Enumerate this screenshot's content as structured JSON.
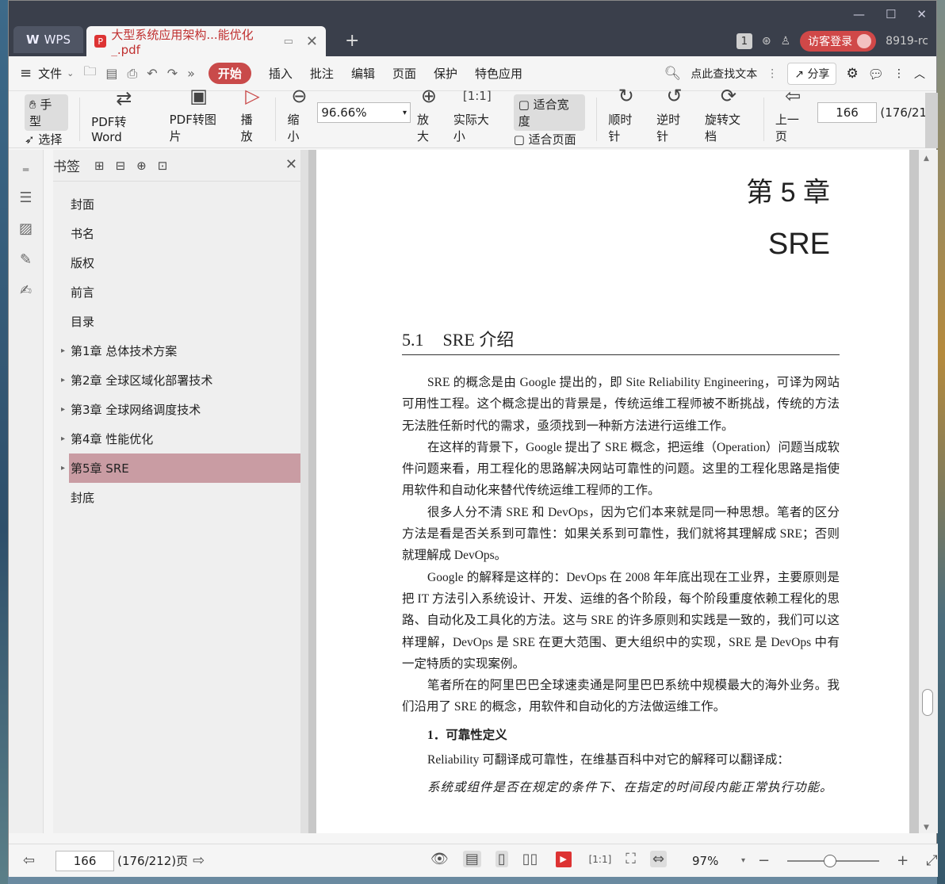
{
  "titlebar": {
    "wps_tab": "WPS",
    "doc_tab": "大型系统应用架构...能优化_.pdf",
    "guest_login": "访客登录",
    "user_id": "8919-rc",
    "window_count": "1"
  },
  "menubar": {
    "file": "文件",
    "tabs": [
      "开始",
      "插入",
      "批注",
      "编辑",
      "页面",
      "保护",
      "特色应用"
    ],
    "search": "点此查找文本",
    "share": "分享"
  },
  "ribbon": {
    "hand": "手型",
    "select": "选择",
    "pdf_to_word": "PDF转Word",
    "pdf_to_image": "PDF转图片",
    "play": "播放",
    "zoom_out": "缩小",
    "zoom_value": "96.66%",
    "zoom_in": "放大",
    "actual_size": "实际大小",
    "fit_width": "适合宽度",
    "fit_page": "适合页面",
    "rotate_cw": "顺时针",
    "rotate_ccw": "逆时针",
    "rotate_doc": "旋转文档",
    "prev_page": "上一页",
    "page_value": "166",
    "page_total": "(176/21"
  },
  "bookmarks": {
    "title": "书签",
    "items": [
      "封面",
      "书名",
      "版权",
      "前言",
      "目录",
      "第1章  总体技术方案",
      "第2章  全球区域化部署技术",
      "第3章  全球网络调度技术",
      "第4章  性能优化",
      "第5章  SRE",
      "封底"
    ]
  },
  "page": {
    "chapter": "第 5 章",
    "chapter_name": "SRE",
    "section_num": "5.1",
    "section_title": "SRE 介绍",
    "paragraphs": [
      "SRE 的概念是由 Google 提出的，即 Site Reliability Engineering，可译为网站可用性工程。这个概念提出的背景是，传统运维工程师被不断挑战，传统的方法无法胜任新时代的需求，亟须找到一种新方法进行运维工作。",
      "在这样的背景下，Google 提出了 SRE 概念，把运维（Operation）问题当成软件问题来看，用工程化的思路解决网站可靠性的问题。这里的工程化思路是指使用软件和自动化来替代传统运维工程师的工作。",
      "很多人分不清 SRE 和 DevOps，因为它们本来就是同一种思想。笔者的区分方法是看是否关系到可靠性：如果关系到可靠性，我们就将其理解成 SRE；否则就理解成 DevOps。",
      "Google 的解释是这样的：DevOps 在 2008 年年底出现在工业界，主要原则是把 IT 方法引入系统设计、开发、运维的各个阶段，每个阶段重度依赖工程化的思路、自动化及工具化的方法。这与 SRE 的许多原则和实践是一致的，我们可以这样理解，DevOps 是 SRE 在更大范围、更大组织中的实现，SRE 是 DevOps 中有一定特质的实现案例。",
      "笔者所在的阿里巴巴全球速卖通是阿里巴巴系统中规模最大的海外业务。我们沿用了 SRE 的概念，用软件和自动化的方法做运维工作。"
    ],
    "subheading": "1．可靠性定义",
    "definition_intro": "Reliability 可翻译成可靠性，在维基百科中对它的解释可以翻译成：",
    "definition": "系统或组件是否在规定的条件下、在指定的时间段内能正常执行功能。"
  },
  "statusbar": {
    "page_value": "166",
    "page_total": "(176/212)页",
    "zoom": "97%"
  },
  "colors": {
    "accent": "#c94a4a",
    "bookmark_active": "#c99ca3",
    "titlebar": "#3a3f4b"
  }
}
